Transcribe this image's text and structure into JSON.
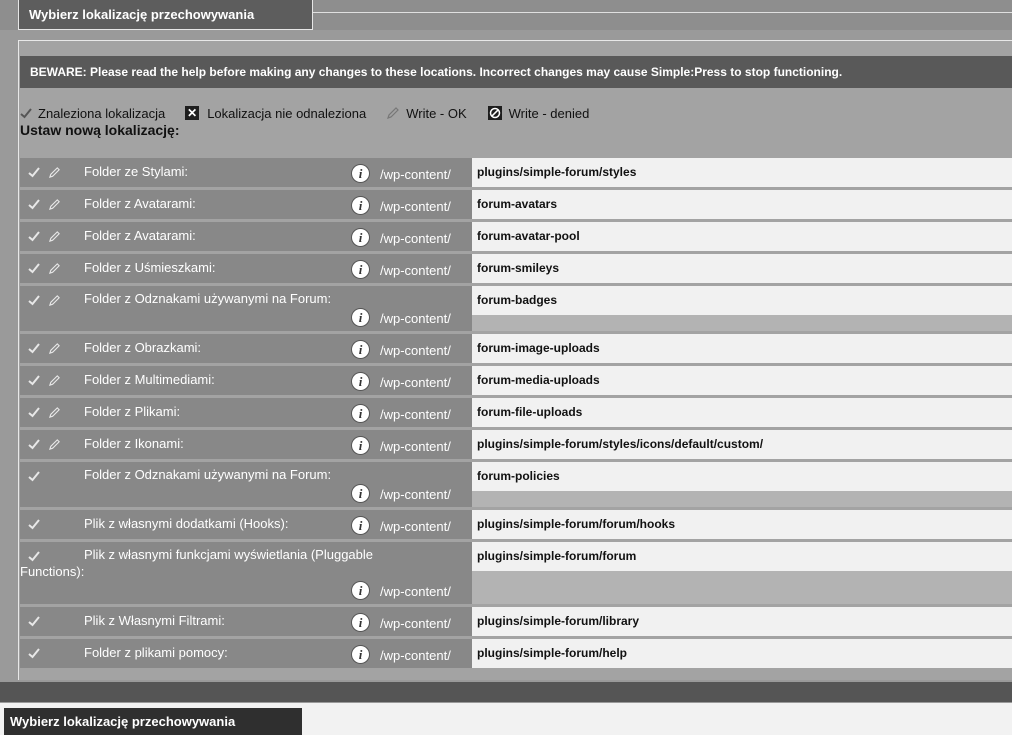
{
  "panel": {
    "title": "Wybierz lokalizację przechowywania",
    "warning": "BEWARE: Please read the help before making any changes to these locations. Incorrect changes may cause Simple:Press to stop functioning.",
    "legend": {
      "found": "Znaleziona lokalizacja",
      "not_found": "Lokalizacja nie odnaleziona",
      "write_ok": "Write - OK",
      "write_denied": "Write - denied"
    },
    "heading": "Ustaw nową lokalizację:",
    "prefix": "/wp-content/",
    "info_glyph": "i"
  },
  "locations": [
    {
      "label": "Folder ze Stylami:",
      "value": "plugins/simple-forum/styles",
      "writable": true
    },
    {
      "label": "Folder z Avatarami:",
      "value": "forum-avatars",
      "writable": true
    },
    {
      "label": "Folder z Avatarami:",
      "value": "forum-avatar-pool",
      "writable": true
    },
    {
      "label": "Folder z Uśmieszkami:",
      "value": "forum-smileys",
      "writable": true
    },
    {
      "label": "Folder z Odznakami używanymi na Forum:",
      "value": "forum-badges",
      "writable": true,
      "wrap": true
    },
    {
      "label": "Folder z Obrazkami:",
      "value": "forum-image-uploads",
      "writable": true
    },
    {
      "label": "Folder z Multimediami:",
      "value": "forum-media-uploads",
      "writable": true
    },
    {
      "label": "Folder z Plikami:",
      "value": "forum-file-uploads",
      "writable": true
    },
    {
      "label": "Folder z Ikonami:",
      "value": "plugins/simple-forum/styles/icons/default/custom/",
      "writable": true
    },
    {
      "label": "Folder z Odznakami używanymi na Forum:",
      "value": "forum-policies",
      "writable": false,
      "wrap": true
    },
    {
      "label": "Plik z własnymi dodatkami (Hooks):",
      "value": "plugins/simple-forum/forum/hooks",
      "writable": false
    },
    {
      "label": "Plik z własnymi funkcjami wyświetlania (Pluggable Functions):",
      "value": "plugins/simple-forum/forum",
      "writable": false,
      "wrap": true,
      "tall": true
    },
    {
      "label": "Plik z Własnymi Filtrami:",
      "value": "plugins/simple-forum/library",
      "writable": false
    },
    {
      "label": "Folder z plikami pomocy:",
      "value": "plugins/simple-forum/help",
      "writable": false
    }
  ],
  "colors": {
    "dark_bar": "#595959",
    "row_bg": "#888888",
    "value_bg": "#f1f1f1"
  }
}
